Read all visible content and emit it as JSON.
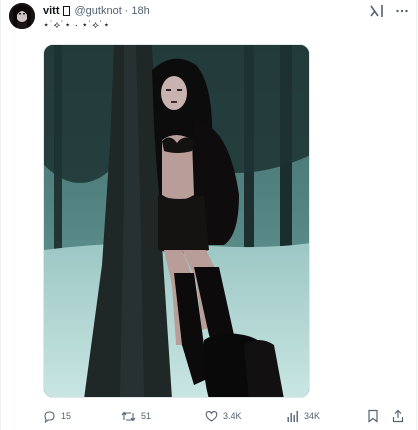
{
  "author": {
    "display_name": "vitt",
    "handle": "@gutknot",
    "separator": "·",
    "timestamp": "18h"
  },
  "tweet": {
    "text": "⋆˙⟡˙⋆ · ⋆˙⟡˙⋆"
  },
  "icons": {
    "grok": "grok-icon",
    "more": "more-icon",
    "reply": "reply-icon",
    "retweet": "retweet-icon",
    "like": "heart-icon",
    "views": "views-icon",
    "bookmark": "bookmark-icon",
    "share": "share-icon"
  },
  "actions": {
    "reply_count": "15",
    "retweet_count": "51",
    "like_count": "3.4K",
    "views_count": "34K"
  },
  "colors": {
    "text_primary": "#0f1419",
    "text_secondary": "#536471",
    "media_tint": "#2d4c4c"
  }
}
